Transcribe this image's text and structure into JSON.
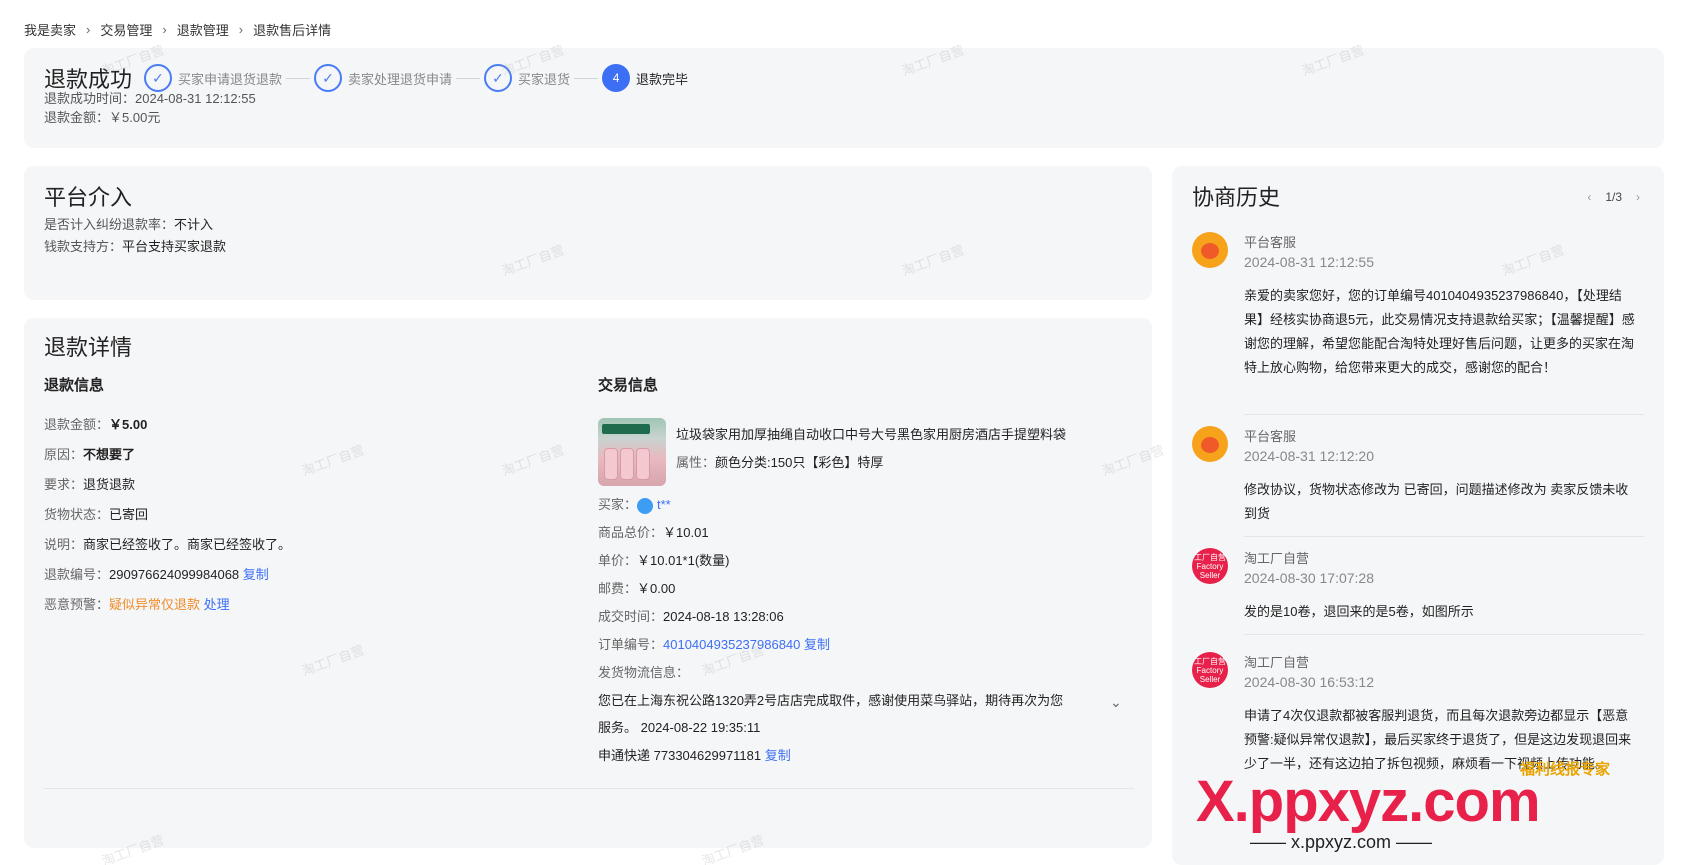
{
  "breadcrumb": [
    "我是卖家",
    "交易管理",
    "退款管理",
    "退款售后详情"
  ],
  "breadcrumb_sep": "›",
  "status": {
    "title": "退款成功",
    "steps": [
      {
        "label": "买家申请退货退款",
        "mark": "✓"
      },
      {
        "label": "卖家处理退货申请",
        "mark": "✓"
      },
      {
        "label": "买家退货",
        "mark": "✓"
      },
      {
        "label": "退款完毕",
        "mark": "4"
      }
    ],
    "time_label": "退款成功时间：",
    "time_value": "2024-08-31 12:12:55",
    "amount_label": "退款金额：",
    "amount_value": "￥5.00元"
  },
  "platform": {
    "title": "平台介入",
    "rate_label": "是否计入纠纷退款率：",
    "rate_value": "不计入",
    "support_label": "钱款支持方：",
    "support_value": "平台支持买家退款"
  },
  "detail": {
    "title": "退款详情",
    "refund_info": {
      "title": "退款信息",
      "amount_label": "退款金额：",
      "amount_value": "￥5.00",
      "reason_label": "原因：",
      "reason_value": "不想要了",
      "request_label": "要求：",
      "request_value": "退货退款",
      "goods_status_label": "货物状态：",
      "goods_status_value": "已寄回",
      "note_label": "说明：",
      "note_value": "商家已经签收了。商家已经签收了。",
      "refund_no_label": "退款编号：",
      "refund_no_value": "290976624099984068",
      "copy": "复制",
      "warning_label": "恶意预警：",
      "warning_value": "疑似异常仅退款",
      "warning_action": "处理"
    },
    "trade_info": {
      "title": "交易信息",
      "product_name": "垃圾袋家用加厚抽绳自动收口中号大号黑色家用厨房酒店手提塑料袋",
      "attr_label": "属性：",
      "attr_value": "颜色分类:150只【彩色】特厚",
      "buyer_label": "买家：",
      "buyer_value": "t**",
      "total_label": "商品总价：",
      "total_value": "￥10.01",
      "unit_label": "单价：",
      "unit_value": "￥10.01*1(数量)",
      "postage_label": "邮费：",
      "postage_value": "￥0.00",
      "deal_time_label": "成交时间：",
      "deal_time_value": "2024-08-18 13:28:06",
      "order_no_label": "订单编号：",
      "order_no_value": "4010404935237986840",
      "copy": "复制",
      "logistics_label": "发货物流信息：",
      "logistics_line1": "您已在上海东祝公路1320弄2号店店完成取件，感谢使用菜鸟驿站，期待再次为您",
      "logistics_line2": "服务。 2024-08-22 19:35:11",
      "express_label": "申通快递",
      "express_no": "773304629971181",
      "express_copy": "复制"
    }
  },
  "history": {
    "title": "协商历史",
    "pager": "1/3",
    "prev": "‹",
    "next": "›",
    "messages": [
      {
        "sender": "平台客服",
        "time": "2024-08-31 12:12:55",
        "body": "亲爱的卖家您好，您的订单编号4010404935237986840，【处理结果】经核实协商退5元，此交易情况支持退款给买家；【温馨提醒】感谢您的理解，希望您能配合淘特处理好售后问题，让更多的买家在淘特上放心购物，给您带来更大的成交，感谢您的配合！"
      },
      {
        "sender": "平台客服",
        "time": "2024-08-31 12:12:20",
        "body": "修改协议，货物状态修改为 已寄回，问题描述修改为 卖家反馈未收到货"
      },
      {
        "sender": "淘工厂自营",
        "time": "2024-08-30 17:07:28",
        "body": "发的是10卷，退回来的是5卷，如图所示"
      },
      {
        "sender": "淘工厂自营",
        "time": "2024-08-30 16:53:12",
        "body": "申请了4次仅退款都被客服判退货，而且每次退款旁边都显示【恶意预警:疑似异常仅退款】，最后买家终于退货了，但是这边发现退回来少了一半，还有这边拍了拆包视频，麻烦看一下视频上传功能。"
      }
    ],
    "shop_avatar_text": "工厂自营 Factory Seller"
  },
  "watermark": "淘工厂自营",
  "overlay": {
    "brand": "X.ppxyz.com",
    "sub": "—— x.ppxyz.com ——",
    "top": "福利线报专家"
  },
  "colors": {
    "accent": "#3d6ff5",
    "warning": "#f08c2a",
    "card_bg": "#f5f6f8"
  }
}
